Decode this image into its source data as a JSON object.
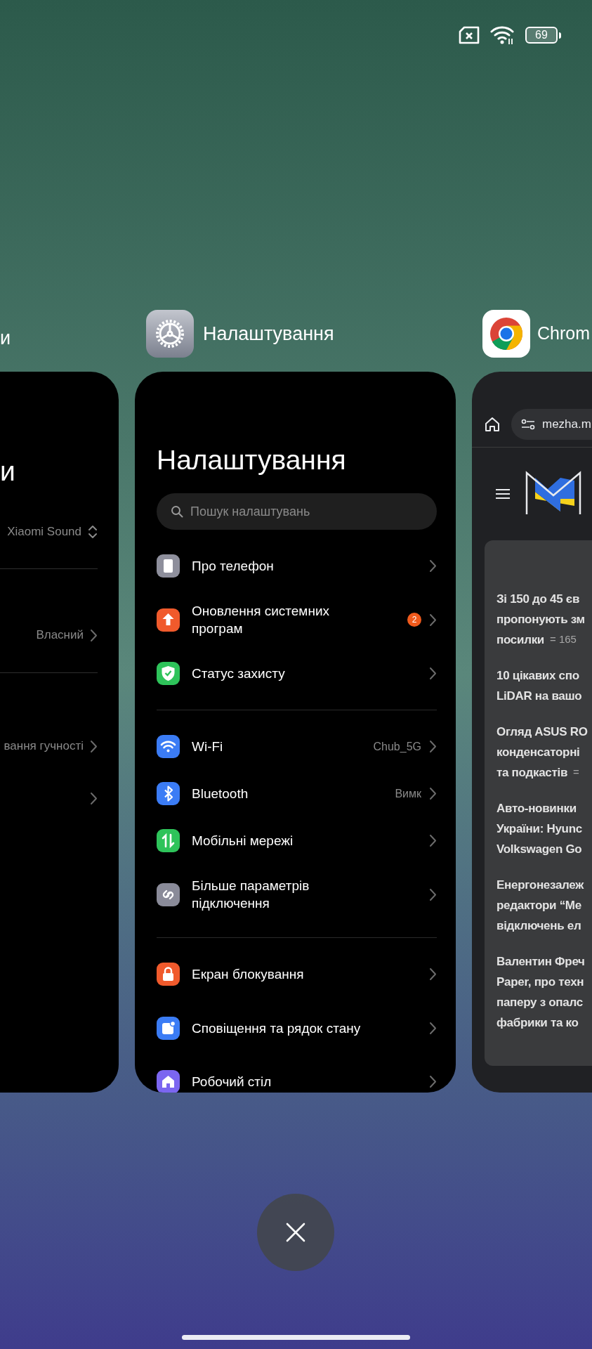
{
  "status_bar": {
    "battery": "69"
  },
  "left_app": {
    "label": "и",
    "card": {
      "title": "и",
      "rows": [
        {
          "value": "Xiaomi Sound",
          "kind": "updown"
        },
        {
          "value": "Власний",
          "kind": "chevron"
        },
        {
          "value": "вання гучності",
          "kind": "chevron"
        },
        {
          "kind": "chevron"
        }
      ]
    }
  },
  "settings_app": {
    "label": "Налаштування",
    "card": {
      "title": "Налаштування",
      "search": {
        "placeholder": "Пошук налаштувань"
      },
      "groups": [
        [
          {
            "kind": "phone",
            "color": "#8e8f9c",
            "label": "Про телефон"
          },
          {
            "kind": "update",
            "color": "#f05a2c",
            "label": "Оновлення системних програм",
            "badge": "2"
          },
          {
            "kind": "security",
            "color": "#2ec35a",
            "label": "Статус захисту"
          }
        ],
        [
          {
            "kind": "wifi",
            "color": "#3b7cf5",
            "label": "Wi-Fi",
            "value": "Chub_5G"
          },
          {
            "kind": "bluetooth",
            "color": "#3b7cf5",
            "label": "Bluetooth",
            "value": "Вимк"
          },
          {
            "kind": "mobile",
            "color": "#2ec35a",
            "label": "Мобільні мережі"
          },
          {
            "kind": "connection",
            "color": "#8a8b99",
            "label": "Більше параметрів підключення"
          }
        ],
        [
          {
            "kind": "lock",
            "color": "#f05a2c",
            "label": "Екран блокування"
          },
          {
            "kind": "notification",
            "color": "#3b7cf5",
            "label": "Сповіщення та рядок стану"
          },
          {
            "kind": "home",
            "color": "#7b66f0",
            "label": "Робочий стіл"
          }
        ]
      ]
    }
  },
  "chrome_app": {
    "label": "Chrom",
    "card": {
      "url": "mezha.m",
      "articles": [
        {
          "lines": [
            "Зі 150 до 45 єв",
            "пропонують зм",
            "посилки"
          ],
          "meta": "= 165"
        },
        {
          "lines": [
            "10 цікавих спо",
            "LiDAR на вашо"
          ]
        },
        {
          "lines": [
            "Огляд ASUS RO",
            "конденсаторні",
            "та подкастів"
          ],
          "meta": "="
        },
        {
          "lines": [
            "Авто-новинки",
            "України: Hyunc",
            "Volkswagen Go"
          ]
        },
        {
          "lines": [
            "Енергонезалеж",
            "редактори “Ме",
            "відключень ел"
          ]
        },
        {
          "lines": [
            "Валентин Фреч",
            "Paper, про техн",
            "паперу з опалс",
            "фабрики та ко"
          ]
        }
      ]
    }
  }
}
